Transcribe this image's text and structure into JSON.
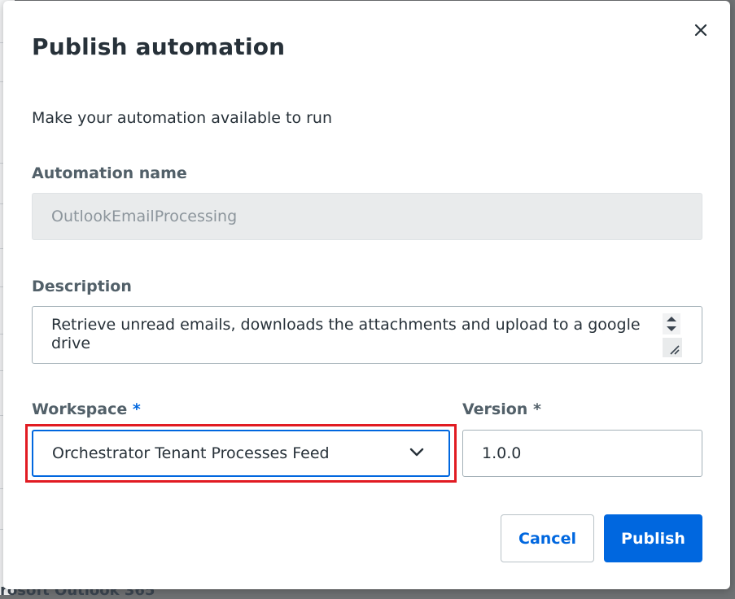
{
  "dialog": {
    "title": "Publish automation",
    "subtitle": "Make your automation available to run",
    "close_icon": "close-icon"
  },
  "fields": {
    "automation_name": {
      "label": "Automation name",
      "value": "OutlookEmailProcessing",
      "disabled": true
    },
    "description": {
      "label": "Description",
      "value": "Retrieve unread emails, downloads the attachments and upload to a google drive"
    },
    "workspace": {
      "label": "Workspace",
      "required_mark": "*",
      "selected": "Orchestrator Tenant Processes Feed",
      "dropdown_icon": "chevron-down-icon"
    },
    "version": {
      "label": "Version *",
      "value": "1.0.0"
    }
  },
  "buttons": {
    "cancel": "Cancel",
    "publish": "Publish"
  },
  "background": {
    "footer_fragment": "rosoft Outlook 365 ^"
  },
  "colors": {
    "accent": "#0067df",
    "highlight": "#e11b22",
    "text": "#273139",
    "label": "#526069"
  }
}
